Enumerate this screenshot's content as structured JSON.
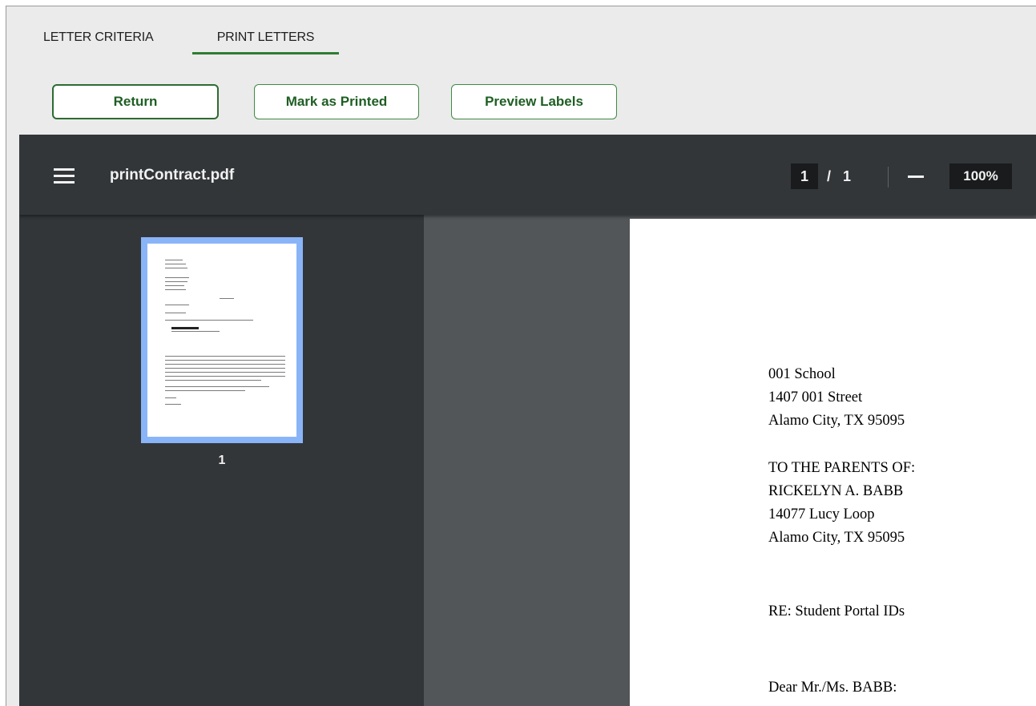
{
  "tabs": {
    "criteria": "LETTER CRITERIA",
    "print": "PRINT LETTERS",
    "active": "print"
  },
  "buttons": {
    "return": "Return",
    "mark_printed": "Mark as Printed",
    "preview_labels": "Preview Labels"
  },
  "viewer": {
    "file_name": "printContract.pdf",
    "current_page": "1",
    "separator": "/",
    "total_pages": "1",
    "zoom": "100%",
    "thumbnail_label": "1",
    "icons": [
      "menu-icon",
      "zoom-out-icon"
    ]
  },
  "letter": {
    "sender": [
      "001 School",
      "1407 001 Street",
      "Alamo City, TX 95095"
    ],
    "recipient": [
      "TO THE PARENTS OF:",
      "RICKELYN A. BABB",
      "14077 Lucy Loop",
      "Alamo City, TX 95095"
    ],
    "subject": "RE: Student Portal IDs",
    "salutation": "Dear Mr./Ms. BABB:"
  },
  "colors": {
    "accent_green": "#2e7d32",
    "toolbar": "#323639",
    "viewer_bg": "#525659",
    "thumb_highlight": "#8ab4f8"
  }
}
